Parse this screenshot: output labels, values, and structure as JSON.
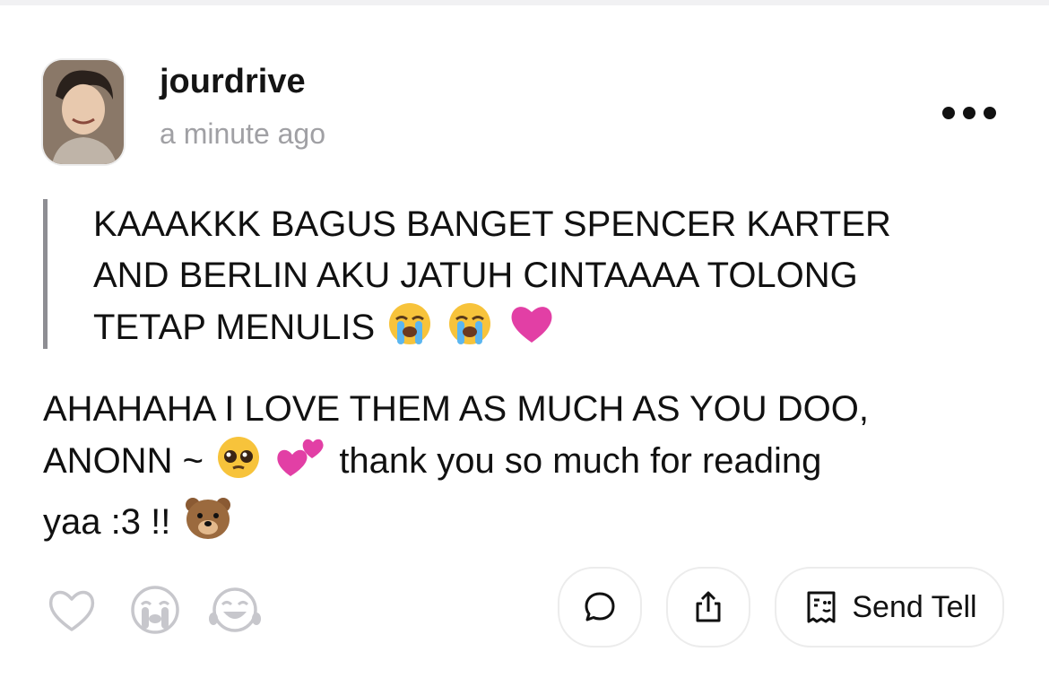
{
  "post": {
    "username": "jourdrive",
    "timestamp": "a minute ago"
  },
  "question": {
    "line1": "KAAAKKK BAGUS BANGET SPENCER KARTER",
    "line2": "AND BERLIN AKU JATUH CINTAAAA TOLONG",
    "line3": "TETAP MENULIS"
  },
  "answer": {
    "line1": "AHAHAHA I LOVE THEM AS MUCH AS YOU DOO,",
    "line2_a": "ANONN ~",
    "line2_b": "thank you so much for reading",
    "line3": "yaa :3 !!"
  },
  "actions": {
    "send_tell_label": "Send Tell"
  },
  "icons": {
    "more": "more-options-icon",
    "heart": "heart-icon",
    "crying": "crying-face-icon",
    "laughing": "laughing-face-icon",
    "comment": "comment-bubble-icon",
    "share": "share-icon",
    "tell": "send-tell-icon"
  },
  "colors": {
    "text": "#111111",
    "muted": "#a0a0a4",
    "quote_bar": "#8e8e93",
    "icon_gray": "#c7c7cc",
    "pill_border": "#ececec"
  }
}
